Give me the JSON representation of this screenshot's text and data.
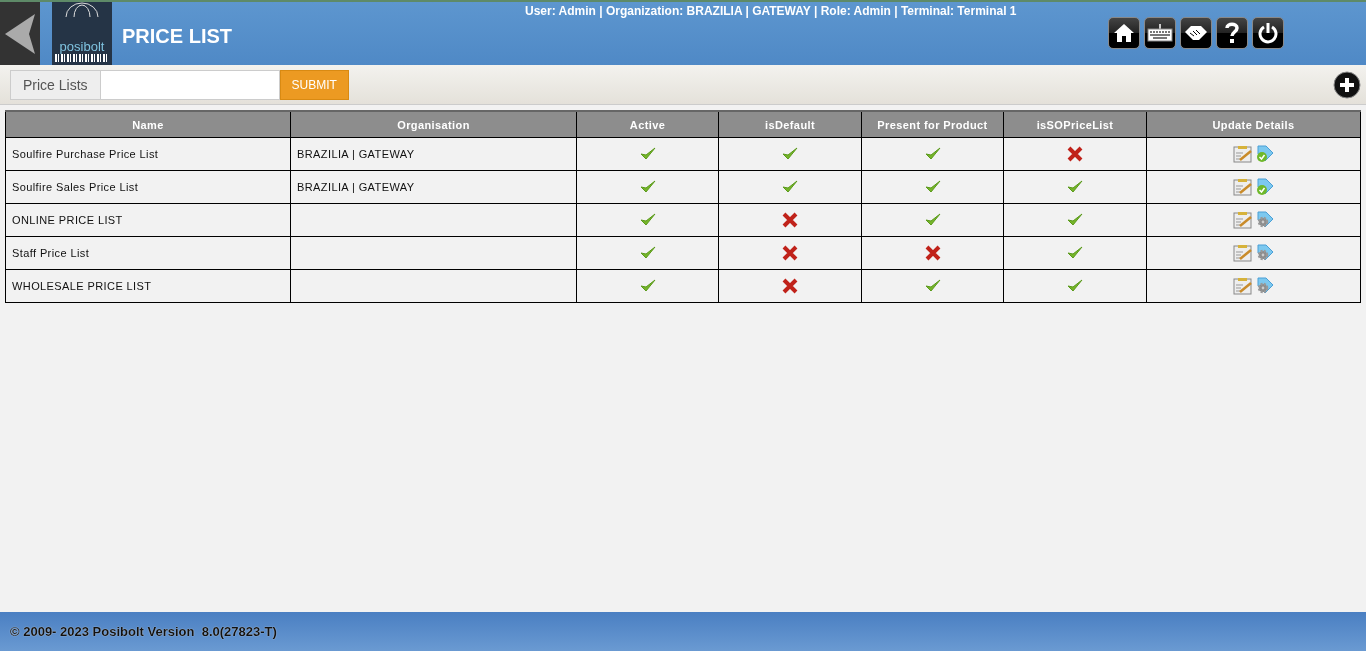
{
  "header": {
    "logo_text": "posibolt",
    "title": "PRICE LIST",
    "session_info": "User: Admin | Organization: BRAZILIA | GATEWAY | Role: Admin | Terminal: Terminal 1"
  },
  "toolbar": {
    "filter_label": "Price Lists",
    "submit": "SUBMIT"
  },
  "table": {
    "columns": [
      "Name",
      "Organisation",
      "Active",
      "isDefault",
      "Present for Product",
      "isSOPriceList",
      "Update Details"
    ],
    "rows": [
      {
        "name": "Soulfire Purchase Price List",
        "organisation": "BRAZILIA | GATEWAY",
        "active": true,
        "is_default": true,
        "present_for_product": true,
        "is_so_price_list": false,
        "tag_checked": true
      },
      {
        "name": "Soulfire Sales Price List",
        "organisation": "BRAZILIA | GATEWAY",
        "active": true,
        "is_default": true,
        "present_for_product": true,
        "is_so_price_list": true,
        "tag_checked": true
      },
      {
        "name": "ONLINE PRICE LIST",
        "organisation": "",
        "active": true,
        "is_default": false,
        "present_for_product": true,
        "is_so_price_list": true,
        "tag_checked": false
      },
      {
        "name": "Staff Price List",
        "organisation": "",
        "active": true,
        "is_default": false,
        "present_for_product": false,
        "is_so_price_list": true,
        "tag_checked": false
      },
      {
        "name": "WHOLESALE PRICE LIST",
        "organisation": "",
        "active": true,
        "is_default": false,
        "present_for_product": true,
        "is_so_price_list": true,
        "tag_checked": false
      }
    ]
  },
  "footer": {
    "copyright": "© 2009- 2023 Posibolt Version  8.0(27823-T)"
  }
}
